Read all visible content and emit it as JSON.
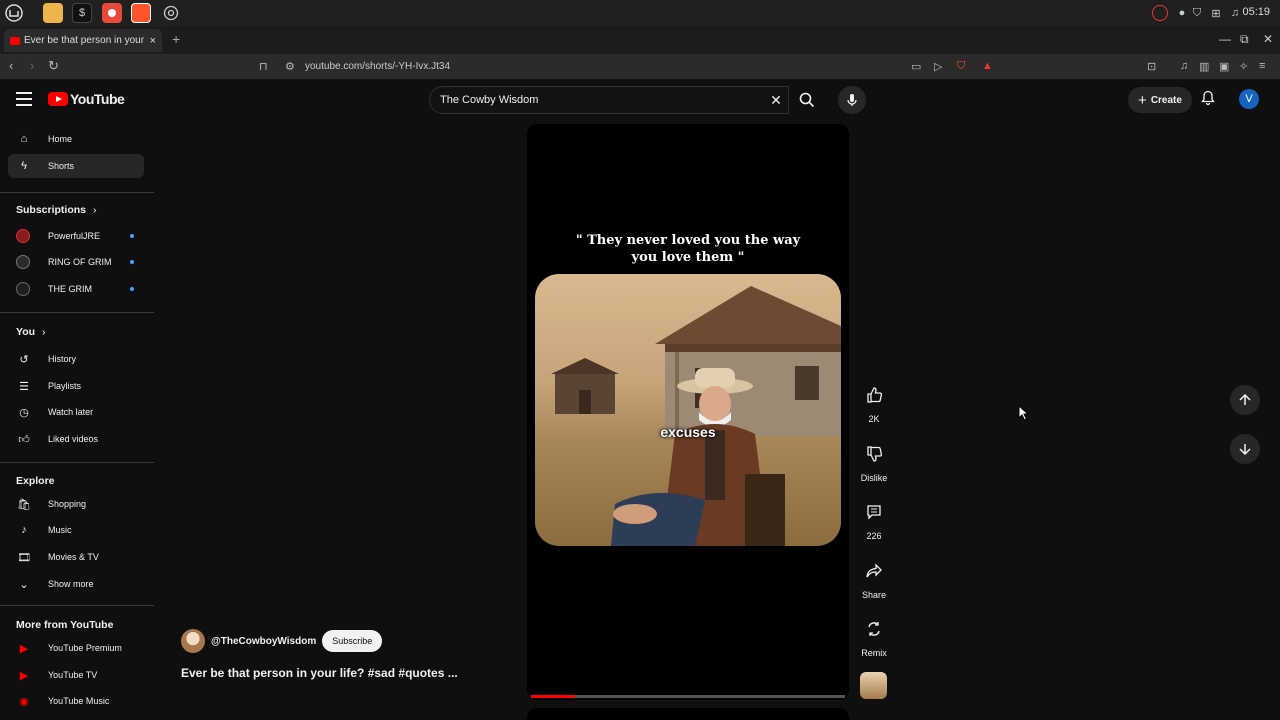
{
  "os": {
    "clock": "05:19"
  },
  "browser": {
    "tab_title": "Ever be that person in your life? #sad #quotes ...",
    "tab_close": "×",
    "new_tab": "+",
    "url": "youtube.com/shorts/-YH-Ivx.Jt34"
  },
  "header": {
    "logo_text": "YouTube",
    "search_value": "The Cowby Wisdom",
    "search_placeholder": "Search",
    "create_label": "Create",
    "avatar_letter": "V"
  },
  "sidebar": {
    "main": [
      {
        "label": "Home",
        "icon": "home-icon"
      },
      {
        "label": "Shorts",
        "icon": "shorts-icon",
        "active": true
      }
    ],
    "subscriptions_title": "Subscriptions",
    "subscriptions": [
      {
        "label": "PowerfulJRE",
        "color": "#8b1a1a"
      },
      {
        "label": "RING OF GRIM",
        "color": "#2a2a2a"
      },
      {
        "label": "THE GRIM",
        "color": "#1e1e1e"
      }
    ],
    "you_title": "You",
    "you_items": [
      {
        "label": "History",
        "icon": "history-icon"
      },
      {
        "label": "Playlists",
        "icon": "playlists-icon"
      },
      {
        "label": "Watch later",
        "icon": "watch-later-icon"
      },
      {
        "label": "Liked videos",
        "icon": "liked-videos-icon"
      }
    ],
    "explore_title": "Explore",
    "explore_items": [
      {
        "label": "Shopping",
        "icon": "shopping-icon"
      },
      {
        "label": "Music",
        "icon": "music-icon"
      },
      {
        "label": "Movies & TV",
        "icon": "movies-icon"
      },
      {
        "label": "Show more",
        "icon": "chevron-down-icon"
      }
    ],
    "more_title": "More from YouTube",
    "more_items": [
      {
        "label": "YouTube Premium",
        "icon": "youtube-premium-icon"
      },
      {
        "label": "YouTube TV",
        "icon": "youtube-tv-icon"
      },
      {
        "label": "YouTube Music",
        "icon": "youtube-music-icon"
      }
    ]
  },
  "short": {
    "quote": "\" They never loved you the way you love them \"",
    "caption": "excuses",
    "progress": 0.14,
    "channel": "@TheCowboyWisdom",
    "subscribe_label": "Subscribe",
    "title": "Ever be that person in your life? #sad #quotes ..."
  },
  "actions": {
    "likes": "2K",
    "dislike": "Dislike",
    "comments": "226",
    "share": "Share",
    "remix": "Remix"
  },
  "colors": {
    "brand_red": "#ff0000",
    "background": "#0f0f0f",
    "active_item": "#272727",
    "new_dot": "#3ea6ff"
  }
}
